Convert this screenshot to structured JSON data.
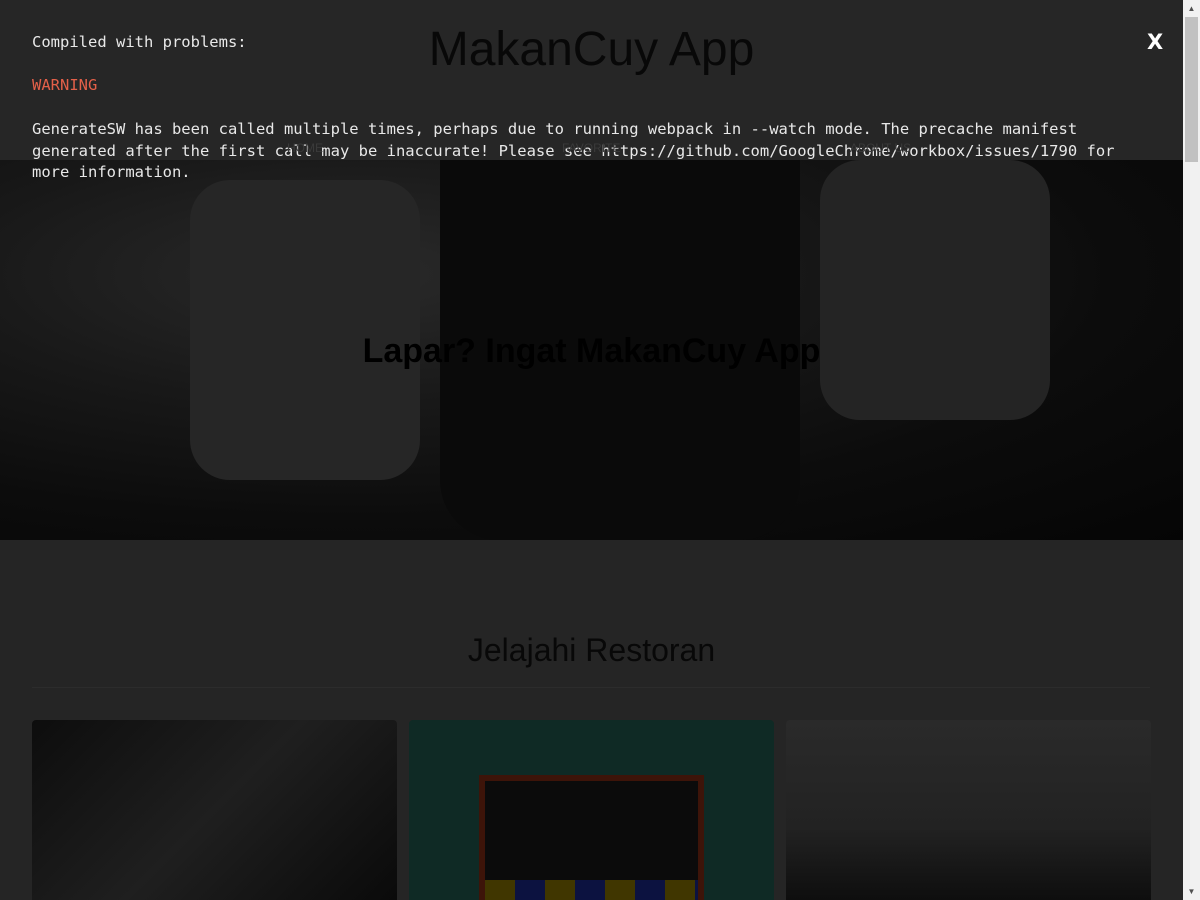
{
  "app": {
    "title": "MakanCuy App",
    "nav": [
      "HOME",
      "FAVORITE",
      "ABOUT US"
    ]
  },
  "hero": {
    "text": "Lapar? Ingat MakanCuy App"
  },
  "main": {
    "section_title": "Jelajahi Restoran"
  },
  "overlay": {
    "heading": "Compiled with problems:",
    "level": "WARNING",
    "message": "GenerateSW has been called multiple times, perhaps due to running webpack in --watch mode. The precache manifest generated after the first call may be inaccurate! Please see https://github.com/GoogleChrome/workbox/issues/1790 for more information.",
    "close_label": "X",
    "warning_color": "#e36049"
  }
}
